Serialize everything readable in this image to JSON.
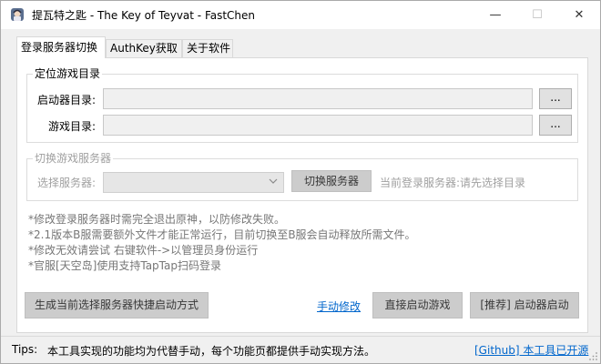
{
  "window": {
    "title": "提瓦特之匙 - The Key of Teyvat - FastChen",
    "minimize_glyph": "—",
    "maximize_glyph": "☐",
    "close_glyph": "✕"
  },
  "tabs": [
    {
      "label": "登录服务器切换",
      "active": true
    },
    {
      "label": "AuthKey获取",
      "active": false
    },
    {
      "label": "关于软件",
      "active": false
    }
  ],
  "locate_group": {
    "title": "定位游戏目录",
    "launcher_label": "启动器目录:",
    "launcher_value": "",
    "game_label": "游戏目录:",
    "game_value": "",
    "browse_label": "..."
  },
  "server_group": {
    "title": "切换游戏服务器",
    "select_label": "选择服务器:",
    "selected_value": "",
    "switch_button": "切换服务器",
    "current_server_text": "当前登录服务器:请先选择目录"
  },
  "notes": [
    "*修改登录服务器时需完全退出原神，以防修改失败。",
    "*2.1版本B服需要额外文件才能正常运行，目前切换至B服会自动释放所需文件。",
    "*修改无效请尝试 右键软件->以管理员身份运行",
    "*官服[天空岛]使用支持TapTap扫码登录"
  ],
  "actions": {
    "shortcut_button": "生成当前选择服务器快捷启动方式",
    "manual_link": "手动修改",
    "direct_launch_button": "直接启动游戏",
    "launcher_start_button": "[推荐] 启动器启动"
  },
  "status": {
    "tips_label": "Tips:",
    "tips_text": "本工具实现的功能均为代替手动，每个功能页都提供手动实现方法。",
    "github_link": "[Github] 本工具已开源"
  },
  "icons": {
    "app": "app-logo-icon",
    "dropdown": "chevron-down-icon",
    "grip": "resize-grip-icon"
  }
}
